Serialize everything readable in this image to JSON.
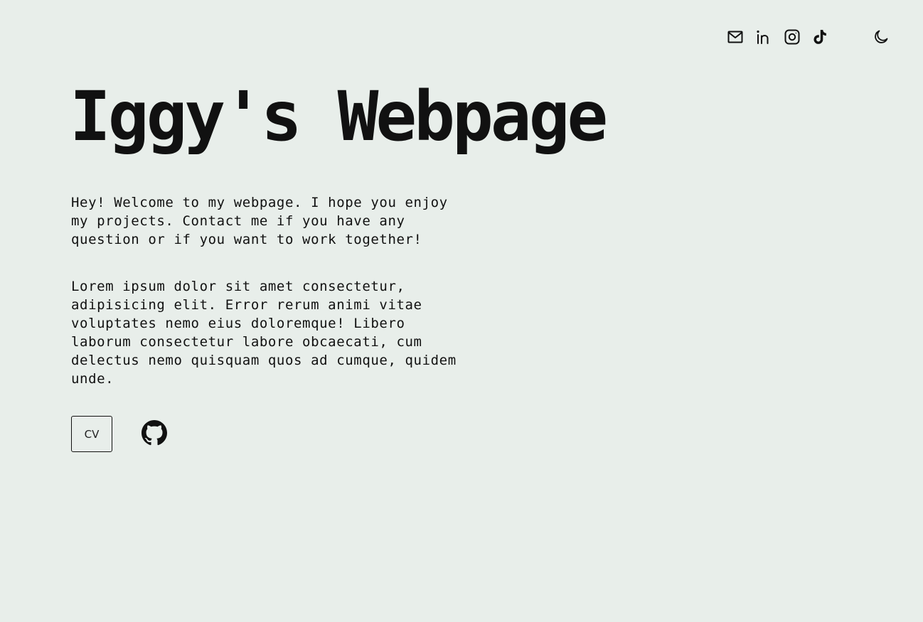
{
  "page": {
    "background": "#e8eeea",
    "text_color": "#111111"
  },
  "nav": {
    "icons": [
      "mail-icon",
      "linkedin-icon",
      "instagram-icon",
      "tiktok-icon"
    ],
    "theme_toggle_icon": "moon-icon"
  },
  "hero": {
    "title": "Iggy's Webpage",
    "intro": "Hey! Welcome to my webpage. I hope you enjoy my projects. Contact me if you have any question or if you want to work together!",
    "body": "Lorem ipsum dolor sit amet consectetur, adipisicing elit. Error rerum animi vitae voluptates nemo eius doloremque! Libero laborum consectetur labore obcaecati, cum delectus nemo quisquam quos ad cumque, quidem unde."
  },
  "actions": {
    "cv_label": "CV",
    "github_icon": "github-icon"
  }
}
